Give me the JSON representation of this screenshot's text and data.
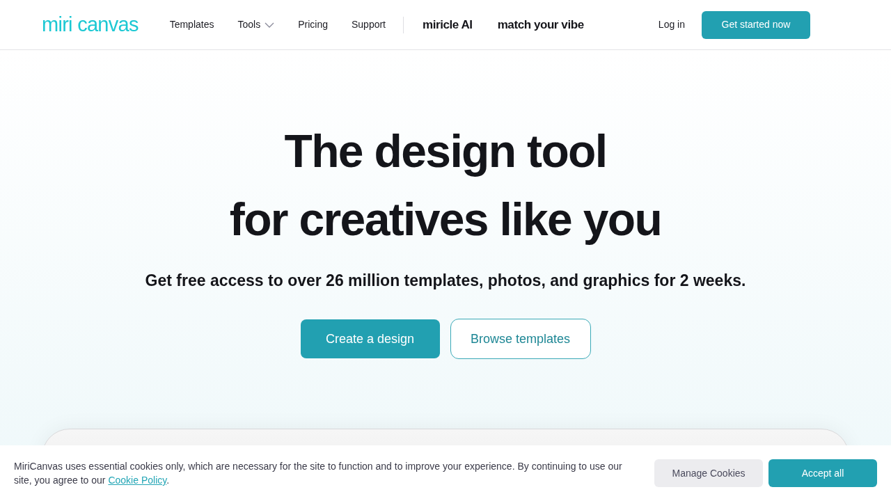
{
  "header": {
    "logo": "miri canvas",
    "nav": [
      {
        "label": "Templates",
        "kind": "link"
      },
      {
        "label": "Tools",
        "kind": "dropdown"
      },
      {
        "label": "Pricing",
        "kind": "link"
      },
      {
        "label": "Support",
        "kind": "link"
      }
    ],
    "brand_links": [
      "miricle AI",
      "match your vibe"
    ],
    "login": "Log in",
    "cta": "Get started now"
  },
  "hero": {
    "title_lines": [
      "The design tool",
      "for creatives like you"
    ],
    "subtitle": "Get free access to over 26 million templates, photos, and graphics for 2 weeks.",
    "buttons": [
      {
        "label": "Create a design",
        "kind": "primary"
      },
      {
        "label": "Browse templates",
        "kind": "secondary"
      }
    ]
  },
  "cookie_banner": {
    "text": "MiriCanvas uses essential cookies only, which are necessary for the site to function and to improve your experience. By continuing to use our site, you agree to our",
    "link": "Cookie Policy",
    "text_end": ".",
    "buttons": [
      {
        "label": "Manage Cookies",
        "kind": "secondary"
      },
      {
        "label": "Accept all",
        "kind": "primary"
      }
    ]
  }
}
